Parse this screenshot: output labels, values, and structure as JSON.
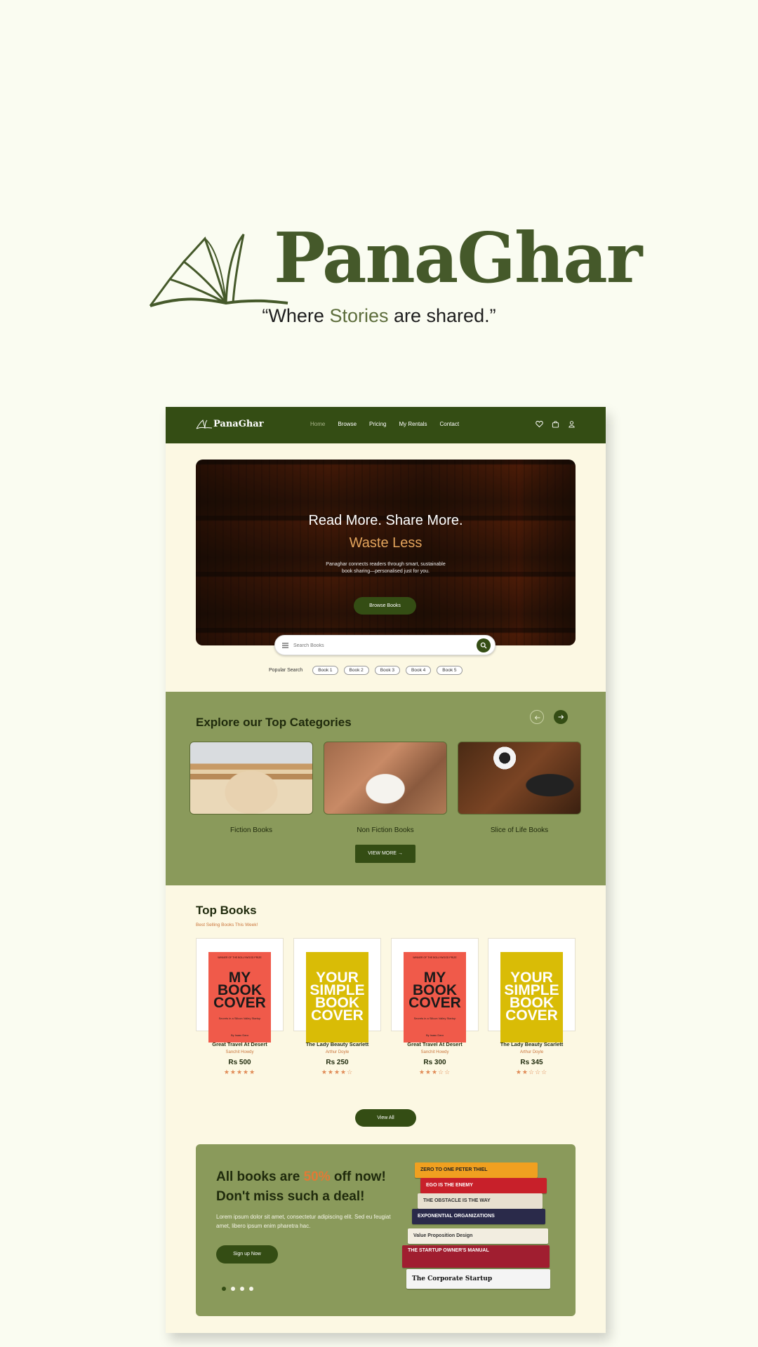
{
  "brand": {
    "name": "PanaGhar",
    "tagline_open": "“Where ",
    "tagline_highlight": "Stories",
    "tagline_close": " are shared.”",
    "icon": "open-book-icon",
    "color": "#45592a"
  },
  "navbar": {
    "brand": "PanaGhar",
    "links": [
      "Home",
      "Browse",
      "Pricing",
      "My Rentals",
      "Contact"
    ],
    "active": "Home",
    "icons": [
      "heart-icon",
      "bag-icon",
      "user-icon"
    ],
    "bg": "#344d14"
  },
  "hero": {
    "title": "Read More. Share More.",
    "subtitle": "Waste Less",
    "description": "Panaghar connects readers through smart, sustainable book sharing—personalised just for you.",
    "button": "Browse Books"
  },
  "search": {
    "placeholder": "Search Books",
    "popular_label": "Popular Search",
    "chips": [
      "Book 1",
      "Book 2",
      "Book 3",
      "Book 4",
      "Book 5"
    ]
  },
  "categories": {
    "title": "Explore our Top Categories",
    "items": [
      "Fiction Books",
      "Non Fiction Books",
      "Slice of Life Books"
    ],
    "view_more": "VIEW MORE →"
  },
  "top_books": {
    "title": "Top Books",
    "subtitle": "Best Selling Books This Week!",
    "books": [
      {
        "title": "Great Travel At Desert",
        "author": "Sanchit Howdy",
        "price": "Rs 500",
        "rating": 5,
        "stars": "★★★★★",
        "cover": "red",
        "cover_text": "MY BOOK COVER",
        "cover_top": "WINNER OF THE BOLLYWOOD PRIZE",
        "cover_small": "Secrets in a Silicon Valley Startup",
        "cover_author": "By Isaac Daro"
      },
      {
        "title": "The Lady Beauty Scarlett",
        "author": "Arthur Doyle",
        "price": "Rs 250",
        "rating": 4,
        "stars": "★★★★☆",
        "cover": "yellow",
        "cover_text": "YOUR SIMPLE BOOK COVER",
        "cover_top": "",
        "cover_small": "",
        "cover_author": ""
      },
      {
        "title": "Great Travel At Desert",
        "author": "Sanchit Howdy",
        "price": "Rs 300",
        "rating": 3,
        "stars": "★★★☆☆",
        "cover": "red",
        "cover_text": "MY BOOK COVER",
        "cover_top": "WINNER OF THE BOLLYWOOD PRIZE",
        "cover_small": "Secrets in a Silicon Valley Startup",
        "cover_author": "By Isaac Daro"
      },
      {
        "title": "The Lady Beauty Scarlett",
        "author": "Arthur Doyle",
        "price": "Rs 345",
        "rating": 2,
        "stars": "★★☆☆☆",
        "cover": "yellow",
        "cover_text": "YOUR SIMPLE BOOK COVER",
        "cover_top": "",
        "cover_small": "",
        "cover_author": ""
      }
    ],
    "view_all": "View All"
  },
  "promo": {
    "line1_before": "All books are ",
    "line1_pct": "50%",
    "line1_after": " off now!",
    "line2": "Don't miss such a deal!",
    "description": "Lorem ipsum dolor sit amet, consectetur adipiscing elit. Sed eu feugiat amet, libero ipsum enim pharetra hac.",
    "button": "Sign up Now",
    "stack_titles": [
      "ZERO TO ONE  PETER THIEL",
      "EGO IS THE ENEMY",
      "THE OBSTACLE IS THE WAY",
      "EXPONENTIAL ORGANIZATIONS",
      "Value Proposition Design",
      "THE STARTUP OWNER'S MANUAL",
      "The Corporate Startup"
    ]
  },
  "colors": {
    "accent": "#344d14",
    "olive": "#8a9a5b",
    "orange": "#e27a35",
    "cream": "#fcf8e3"
  }
}
